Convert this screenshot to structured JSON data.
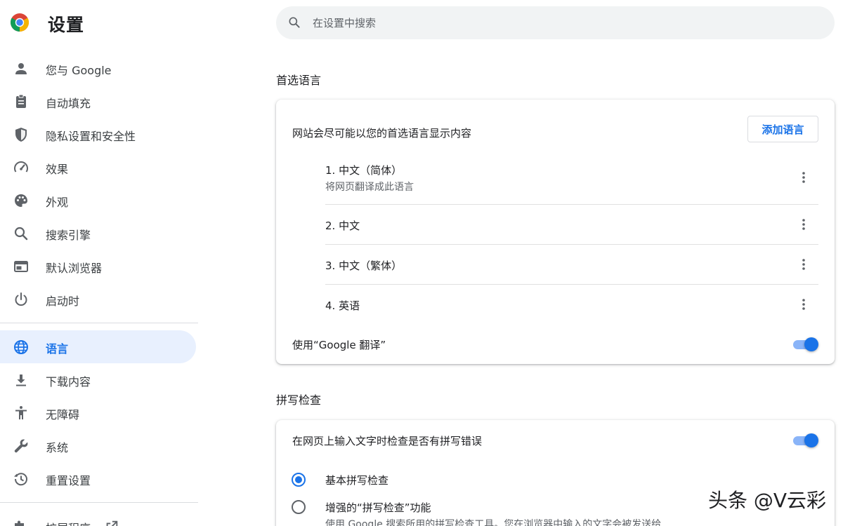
{
  "header": {
    "title": "设置",
    "search_placeholder": "在设置中搜索"
  },
  "sidebar": {
    "items": [
      {
        "label": "您与 Google",
        "icon": "person-icon"
      },
      {
        "label": "自动填充",
        "icon": "clipboard-icon"
      },
      {
        "label": "隐私设置和安全性",
        "icon": "shield-icon"
      },
      {
        "label": "效果",
        "icon": "speedometer-icon"
      },
      {
        "label": "外观",
        "icon": "palette-icon"
      },
      {
        "label": "搜索引擎",
        "icon": "search-icon"
      },
      {
        "label": "默认浏览器",
        "icon": "browser-icon"
      },
      {
        "label": "启动时",
        "icon": "power-icon"
      },
      {
        "label": "语言",
        "icon": "globe-icon",
        "active": true
      },
      {
        "label": "下载内容",
        "icon": "download-icon"
      },
      {
        "label": "无障碍",
        "icon": "accessibility-icon"
      },
      {
        "label": "系统",
        "icon": "wrench-icon"
      },
      {
        "label": "重置设置",
        "icon": "history-icon"
      },
      {
        "label": "扩展程序",
        "icon": "puzzle-icon",
        "external_icon": "open-in-new-icon"
      }
    ]
  },
  "languages_section": {
    "title": "首选语言",
    "description": "网站会尽可能以您的首选语言显示内容",
    "add_button": "添加语言",
    "languages": [
      {
        "label": "1. 中文（简体）",
        "sub": "将网页翻译成此语言"
      },
      {
        "label": "2. 中文"
      },
      {
        "label": "3. 中文（繁体）"
      },
      {
        "label": "4. 英语"
      }
    ],
    "translate_label": "使用“Google 翻译”",
    "translate_enabled": true
  },
  "spellcheck_section": {
    "title": "拼写检查",
    "check_label": "在网页上输入文字时检查是否有拼写错误",
    "check_enabled": true,
    "options": [
      {
        "label": "基本拼写检查",
        "selected": true
      },
      {
        "label": "增强的“拼写检查”功能",
        "sub": "使用 Google 搜索所用的拼写检查工具。您在浏览器中输入的文字会被发送给",
        "selected": false
      }
    ]
  },
  "watermark": "头条 @V云彩",
  "colors": {
    "accent": "#1a73e8",
    "active_bg": "#e8f0fe",
    "search_bg": "#f1f3f4"
  }
}
